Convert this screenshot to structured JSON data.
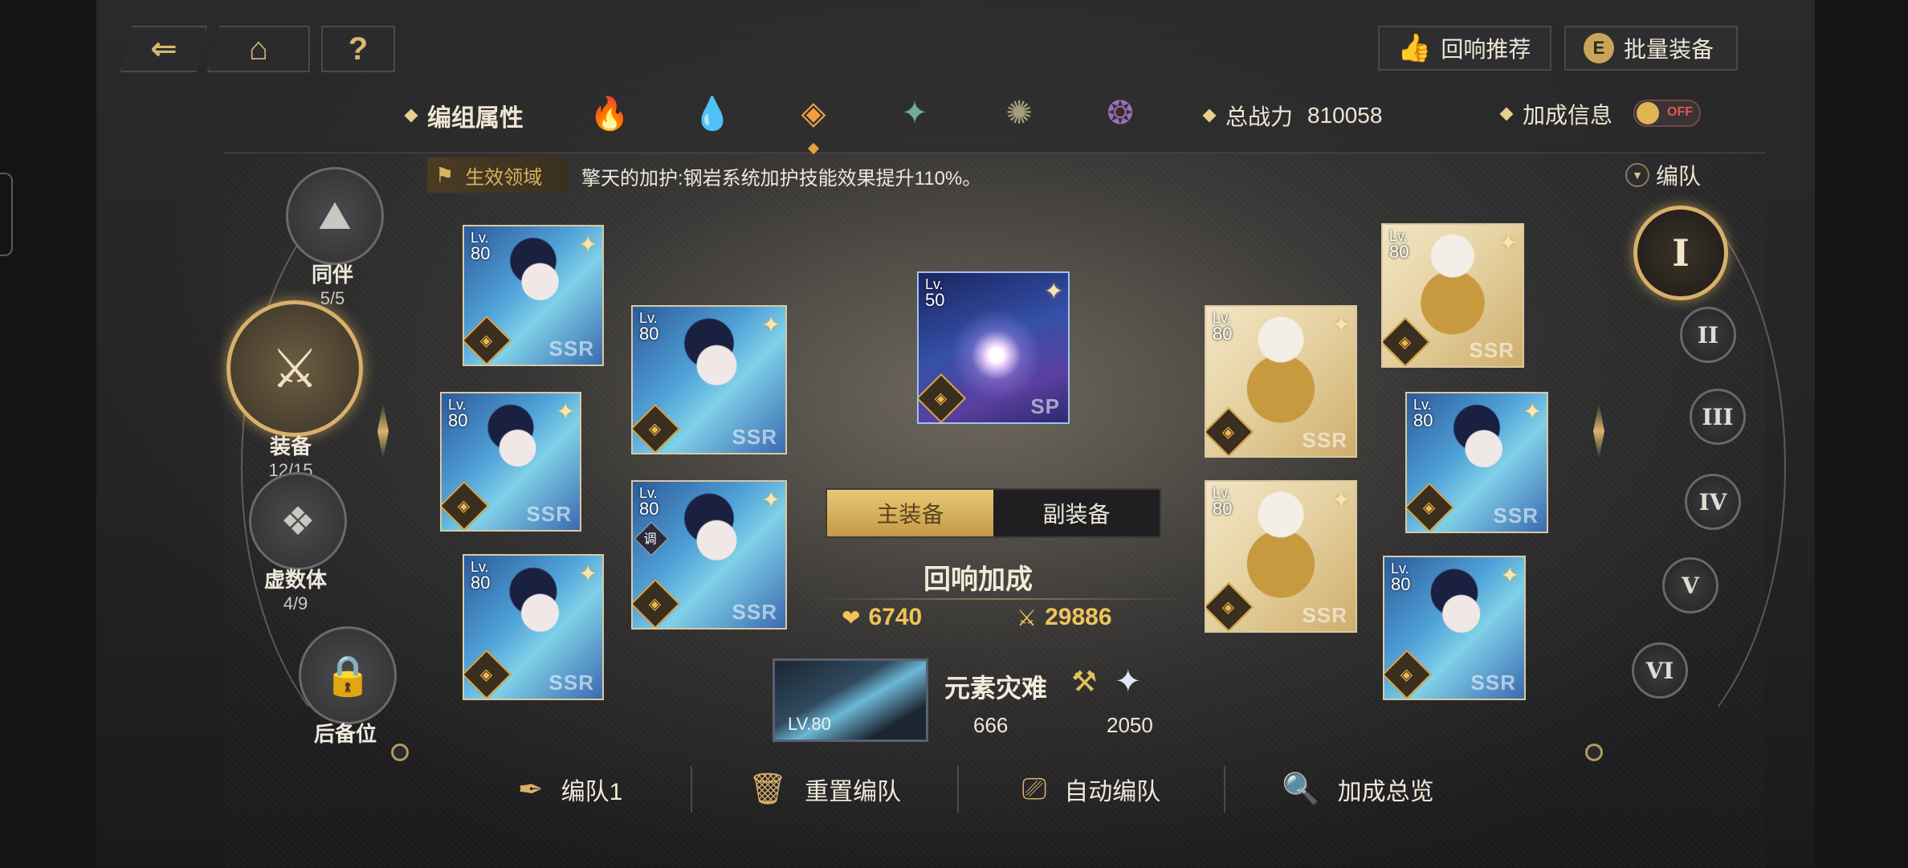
{
  "nav": {
    "back_icon": "back-arrow-icon",
    "home_icon": "home-icon",
    "help_label": "?"
  },
  "top_buttons": {
    "echo_recommend": "回响推荐",
    "batch_equip": "批量装备",
    "batch_badge": "E"
  },
  "attributes": {
    "label": "编组属性",
    "elements": [
      {
        "name": "fire-element-icon",
        "glyph": "🔥",
        "color": "#c96b5e"
      },
      {
        "name": "water-element-icon",
        "glyph": "💧",
        "color": "#7fa9c8"
      },
      {
        "name": "rock-element-icon",
        "glyph": "◈",
        "color": "#f0a040"
      },
      {
        "name": "wind-element-icon",
        "glyph": "✦",
        "color": "#6fae8c"
      },
      {
        "name": "light-element-icon",
        "glyph": "✺",
        "color": "#a89c80"
      },
      {
        "name": "dark-element-icon",
        "glyph": "❂",
        "color": "#9a6fb8"
      }
    ],
    "active_index": 2
  },
  "power": {
    "label": "总战力",
    "value": "810058"
  },
  "bonus_info": {
    "label": "加成信息",
    "toggle": "OFF"
  },
  "field": {
    "badge": "生效领域",
    "text": "擎天的加护:钢岩系统加护技能效果提升110%。"
  },
  "team_dropdown": "编队",
  "categories": [
    {
      "label": "同伴",
      "count": "5/5",
      "icon": "companion-icon",
      "glyph": "⛰"
    },
    {
      "label": "装备",
      "count": "12/15",
      "icon": "equipment-icon",
      "glyph": "⚔"
    },
    {
      "label": "虚数体",
      "count": "4/9",
      "icon": "imaginary-icon",
      "glyph": "❖"
    },
    {
      "label": "后备位",
      "count": "",
      "icon": "lock-icon",
      "glyph": "🔒"
    }
  ],
  "cards": [
    {
      "lv": "80",
      "rarity": "SSR",
      "style": "blue"
    },
    {
      "lv": "80",
      "rarity": "SSR",
      "style": "blue"
    },
    {
      "lv": "80",
      "rarity": "SSR",
      "style": "blue"
    },
    {
      "lv": "80",
      "rarity": "SSR",
      "style": "blue"
    },
    {
      "lv": "80",
      "rarity": "SSR",
      "style": "blue",
      "tune": "调"
    },
    {
      "lv": "50",
      "rarity": "SP",
      "style": "sp"
    },
    {
      "lv": "80",
      "rarity": "SSR",
      "style": "gold"
    },
    {
      "lv": "80",
      "rarity": "SSR",
      "style": "gold"
    },
    {
      "lv": "80",
      "rarity": "SSR",
      "style": "gold"
    },
    {
      "lv": "80",
      "rarity": "SSR",
      "style": "blue"
    },
    {
      "lv": "80",
      "rarity": "SSR",
      "style": "blue"
    }
  ],
  "lv_prefix": "Lv.",
  "equip_tabs": {
    "main": "主装备",
    "sub": "副装备"
  },
  "echo": {
    "title": "回响加成",
    "hp": "6740",
    "atk": "29886"
  },
  "weapon": {
    "lv": "LV.80",
    "name": "元素灾难",
    "val1": "666",
    "val2": "2050"
  },
  "teams": [
    "I",
    "II",
    "III",
    "IV",
    "V",
    "VI"
  ],
  "bottom": [
    {
      "label": "编队1",
      "icon": "quill-icon",
      "glyph": "✒"
    },
    {
      "label": "重置编队",
      "icon": "trash-icon",
      "glyph": "🗑"
    },
    {
      "label": "自动编队",
      "icon": "auto-team-icon",
      "glyph": "⎚"
    },
    {
      "label": "加成总览",
      "icon": "search-icon",
      "glyph": "🔍"
    }
  ]
}
